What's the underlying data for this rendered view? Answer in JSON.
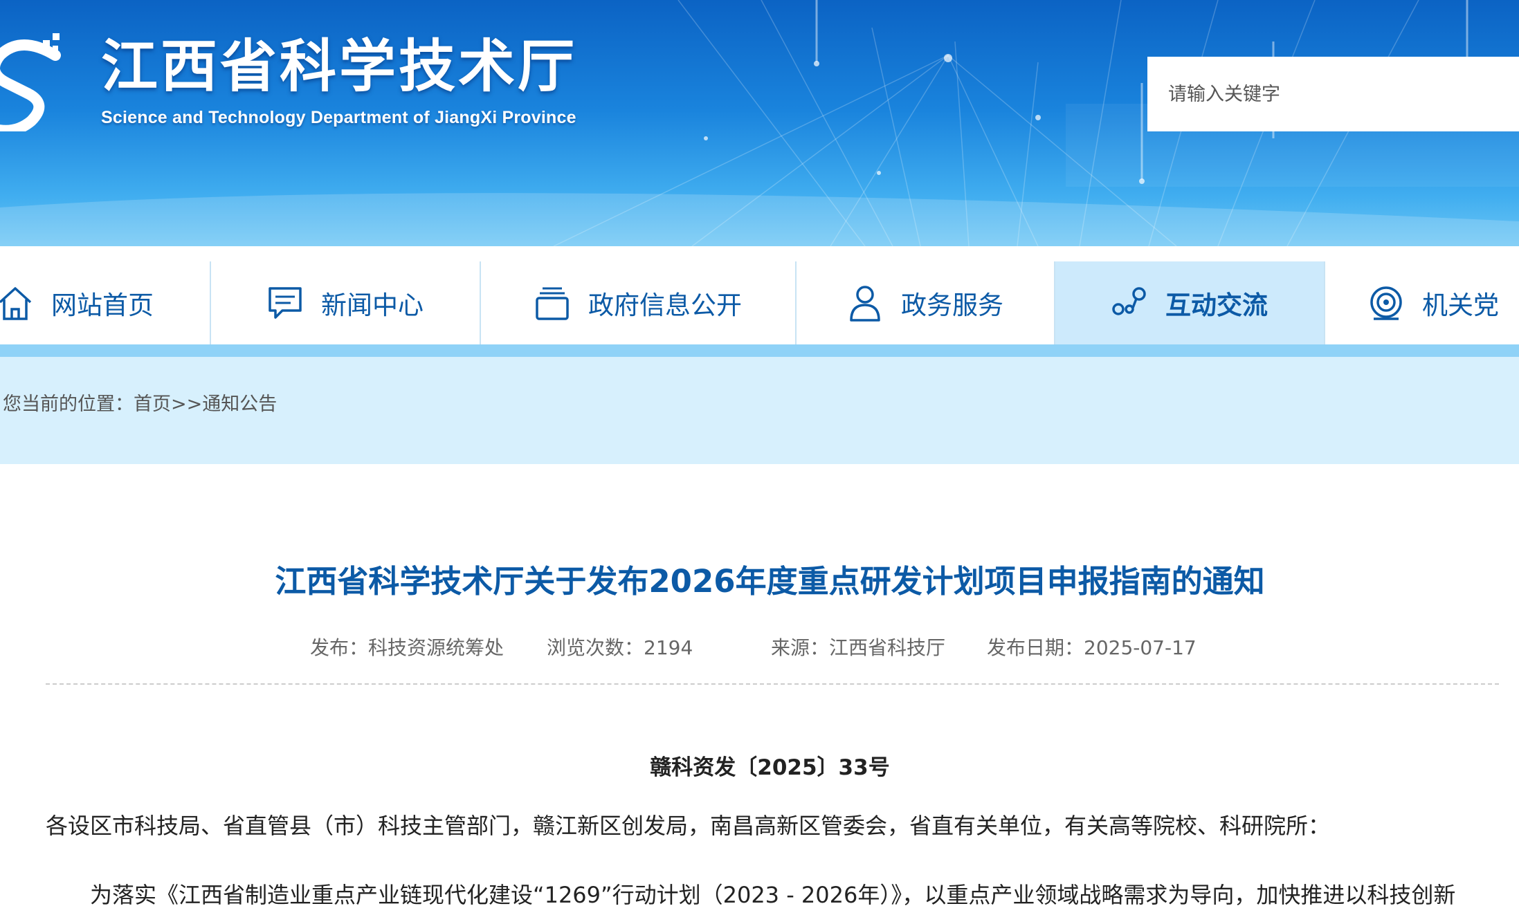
{
  "header": {
    "title": "江西省科学技术厅",
    "subtitle": "Science and Technology Department of JiangXi Province",
    "search_placeholder": "请输入关键字"
  },
  "nav": {
    "items": [
      {
        "label": "网站首页",
        "icon": "home-icon"
      },
      {
        "label": "新闻中心",
        "icon": "chat-bubble-icon"
      },
      {
        "label": "政府信息公开",
        "icon": "stacked-docs-icon"
      },
      {
        "label": "政务服务",
        "icon": "person-icon"
      },
      {
        "label": "互动交流",
        "icon": "connection-icon",
        "active": true
      },
      {
        "label": "机关党",
        "icon": "target-icon"
      }
    ]
  },
  "breadcrumb": {
    "prefix": "您当前的位置：",
    "home": "首页",
    "sep": ">>",
    "current": "通知公告"
  },
  "article": {
    "title": "江西省科学技术厅关于发布2026年度重点研发计划项目申报指南的通知",
    "publisher": "发布：科技资源统筹处",
    "views": "浏览次数：2194",
    "source": "来源：江西省科技厅",
    "date": "发布日期：2025-07-17",
    "doc_number": "赣科资发〔2025〕33号",
    "salutation": "各设区市科技局、省直管县（市）科技主管部门，赣江新区创发局，南昌高新区管委会，省直有关单位，有关高等院校、科研院所：",
    "paragraph": "为落实《江西省制造业重点产业链现代化建设“1269”行动计划（2023 - 2026年）》，以重点产业领域战略需求为导向，加快推进以科技创新"
  },
  "colors": {
    "brand_blue": "#0c5aa6",
    "nav_active_bg": "#cdeafc",
    "breadcrumb_bg": "#d7f0fd"
  }
}
